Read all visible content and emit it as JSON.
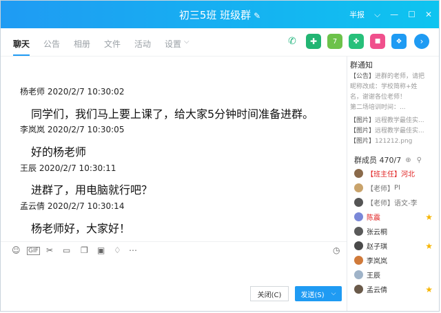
{
  "title": "初三5班 班级群",
  "window_controls": {
    "mode_label": "半报",
    "dropdown": "⌵",
    "min": "—",
    "max": "☐",
    "close": "✕"
  },
  "tabs": [
    "聊天",
    "公告",
    "相册",
    "文件",
    "活动",
    "设置"
  ],
  "messages": [
    {
      "sender": "杨老师",
      "time": "2020/2/7  10:30:02",
      "text": "同学们，我们马上要上课了，给大家5分钟时间准备进群。"
    },
    {
      "sender": "李岚岚",
      "time": "2020/2/7  10:30:05",
      "text": "好的杨老师"
    },
    {
      "sender": "王辰",
      "time": "2020/2/7  10:30:11",
      "text": "进群了，用电脑就行吧？"
    },
    {
      "sender": "孟云倩",
      "time": "2020/2/7  10:30:14",
      "text": "杨老师好，大家好！"
    }
  ],
  "notice": {
    "heading": "群通知",
    "lines": [
      {
        "tag": "【公告】",
        "text": "进群的老师，请把"
      },
      {
        "tag": "",
        "text": "昵称改成：学校简称+姓"
      },
      {
        "tag": "",
        "text": "名，谢谢各位老师！"
      },
      {
        "tag": "",
        "text": "第二场培训时间：..."
      },
      {
        "tag": "【图片】",
        "text": "远程教学最佳实..."
      },
      {
        "tag": "【图片】",
        "text": "远程教学最佳实..."
      },
      {
        "tag": "【图片】",
        "text": "121212.png"
      }
    ]
  },
  "members": {
    "header": "群成员 470/7",
    "list": [
      {
        "role": "【班主任】",
        "name": "河北",
        "color": "#e02020",
        "avatar": "#8a6a4a",
        "star": ""
      },
      {
        "role": "【老师】",
        "name": "PI",
        "color": "#777777",
        "avatar": "#c9a36b",
        "star": ""
      },
      {
        "role": "【老师】",
        "name": "语文-李",
        "color": "#777777",
        "avatar": "#555555",
        "star": ""
      },
      {
        "role": "",
        "name": "陈震",
        "color": "#e02020",
        "avatar": "#7a88d8",
        "star": "★"
      },
      {
        "role": "",
        "name": "张云桐",
        "color": "#333333",
        "avatar": "#5a5a5a",
        "star": ""
      },
      {
        "role": "",
        "name": "赵子琪",
        "color": "#333333",
        "avatar": "#4a4a4a",
        "star": "★"
      },
      {
        "role": "",
        "name": "李岚岚",
        "color": "#333333",
        "avatar": "#d07a3a",
        "star": ""
      },
      {
        "role": "",
        "name": "王辰",
        "color": "#333333",
        "avatar": "#9fb3c8",
        "star": ""
      },
      {
        "role": "",
        "name": "孟云倩",
        "color": "#333333",
        "avatar": "#6a5a4a",
        "star": "★"
      }
    ]
  },
  "buttons": {
    "close": "关闭(C)",
    "send": "发送(S)"
  },
  "colors": {
    "accent": "#1f9bf3"
  }
}
